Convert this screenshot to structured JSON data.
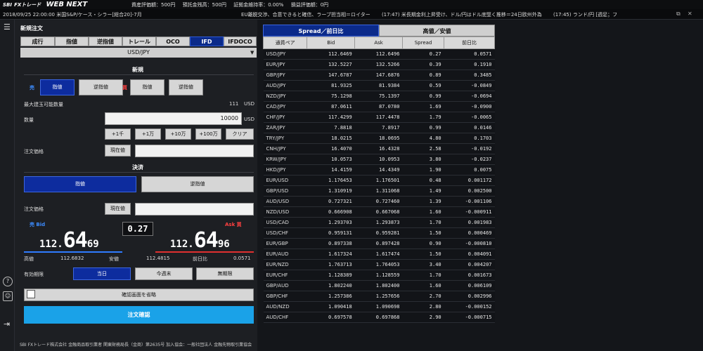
{
  "app": {
    "brand_sbi": "SBI",
    "brand_fx": "FXトレード",
    "brand_name": "WEB NEXT"
  },
  "stats": [
    "資産評価額：500円",
    "預託金残高：500円",
    "証拠金維持率：0.00%",
    "損益評価額：0円"
  ],
  "ticker": {
    "left": "2018/09/25 22:00:00 米国S&P/ケース・シラー[総合20]-7月",
    "news": [
      "EU離脱交渉、合意できると確信、ラーブ担当相＝ロイター",
      "(17:47) 米長期金利上昇受け、ドル/円はドル底堅く推移＝24日欧州外為",
      "(17:45) ランド/円 [週足；フ"
    ]
  },
  "order": {
    "title": "新規注文",
    "tabs": [
      "成行",
      "指値",
      "逆指値",
      "トレール",
      "OCO",
      "IFD",
      "IFDOCO"
    ],
    "active_tab": "IFD",
    "pair": "USD/JPY",
    "new_section": "新規",
    "sell_label": "売",
    "buy_label": "買",
    "limit_label": "指値",
    "stop_label": "逆指値",
    "max_label": "最大建玉可能数量",
    "max_value": "111",
    "max_unit": "USD",
    "qty_label": "数量",
    "qty_value": "10000",
    "qty_unit": "USD",
    "qty_buttons": [
      "+1千",
      "+1万",
      "+10万",
      "+100万",
      "クリア"
    ],
    "price_label": "注文価格",
    "current_btn": "現在値",
    "settle_section": "決済",
    "settle_limit": "指値",
    "settle_stop": "逆指値",
    "bid_label": "売 Bid",
    "ask_label": "Ask 買",
    "bid_price": {
      "a": "112.",
      "b": "64",
      "c": "69"
    },
    "ask_price": {
      "a": "112.",
      "b": "64",
      "c": "96"
    },
    "spread": "0.27",
    "high_label": "高値",
    "high_value": "112.6832",
    "low_label": "安値",
    "low_value": "112.4815",
    "change_label": "前日比",
    "change_value": "0.0571",
    "expiry_label": "有効期限",
    "expiry_options": [
      "当日",
      "今週末",
      "無期限"
    ],
    "skip_confirm": "確認画面を省略",
    "confirm_btn": "注文確認",
    "footer": "SBI FXトレード株式会社 金融商品取引業者 関東財務局長（金商）第2635号 加入協会：一般社団法人 金融先物取引業協会"
  },
  "rates": {
    "tabs": [
      "Spread／前日比",
      "高値／安値"
    ],
    "headers": [
      "通貨ペア",
      "Bid",
      "Ask",
      "Spread",
      "前日比"
    ],
    "rows": [
      [
        "USD/JPY",
        "112.6469",
        "112.6496",
        "0.27",
        "0.0571"
      ],
      [
        "EUR/JPY",
        "132.5227",
        "132.5266",
        "0.39",
        "0.1910"
      ],
      [
        "GBP/JPY",
        "147.6787",
        "147.6876",
        "0.89",
        "0.3485"
      ],
      [
        "AUD/JPY",
        "81.9325",
        "81.9384",
        "0.59",
        "-0.0849"
      ],
      [
        "NZD/JPY",
        "75.1298",
        "75.1397",
        "0.99",
        "-0.0694"
      ],
      [
        "CAD/JPY",
        "87.0611",
        "87.0780",
        "1.69",
        "-0.0900"
      ],
      [
        "CHF/JPY",
        "117.4299",
        "117.4478",
        "1.79",
        "-0.0065"
      ],
      [
        "ZAR/JPY",
        "7.8818",
        "7.8917",
        "0.99",
        "0.0146"
      ],
      [
        "TRY/JPY",
        "18.0215",
        "18.0695",
        "4.80",
        "0.1703"
      ],
      [
        "CNH/JPY",
        "16.4070",
        "16.4328",
        "2.58",
        "-0.0192"
      ],
      [
        "KRW/JPY",
        "10.0573",
        "10.0953",
        "3.80",
        "-0.0237"
      ],
      [
        "HKD/JPY",
        "14.4159",
        "14.4349",
        "1.90",
        "0.0075"
      ],
      [
        "EUR/USD",
        "1.176453",
        "1.176501",
        "0.48",
        "0.001172"
      ],
      [
        "GBP/USD",
        "1.310919",
        "1.311068",
        "1.49",
        "0.002500"
      ],
      [
        "AUD/USD",
        "0.727321",
        "0.727460",
        "1.39",
        "-0.001106"
      ],
      [
        "NZD/USD",
        "0.666908",
        "0.667068",
        "1.60",
        "-0.000911"
      ],
      [
        "USD/CAD",
        "1.293703",
        "1.293873",
        "1.70",
        "0.001983"
      ],
      [
        "USD/CHF",
        "0.959131",
        "0.959281",
        "1.50",
        "0.000469"
      ],
      [
        "EUR/GBP",
        "0.897338",
        "0.897428",
        "0.90",
        "-0.000810"
      ],
      [
        "EUR/AUD",
        "1.617324",
        "1.617474",
        "1.50",
        "0.004091"
      ],
      [
        "EUR/NZD",
        "1.763713",
        "1.764053",
        "3.40",
        "0.004207"
      ],
      [
        "EUR/CHF",
        "1.128389",
        "1.128559",
        "1.70",
        "0.001673"
      ],
      [
        "GBP/AUD",
        "1.802240",
        "1.802400",
        "1.60",
        "0.006109"
      ],
      [
        "GBP/CHF",
        "1.257386",
        "1.257656",
        "2.70",
        "0.002996"
      ],
      [
        "AUD/NZD",
        "1.090418",
        "1.090698",
        "2.80",
        "-0.000152"
      ],
      [
        "AUD/CHF",
        "0.697578",
        "0.697868",
        "2.90",
        "-0.000715"
      ]
    ]
  }
}
